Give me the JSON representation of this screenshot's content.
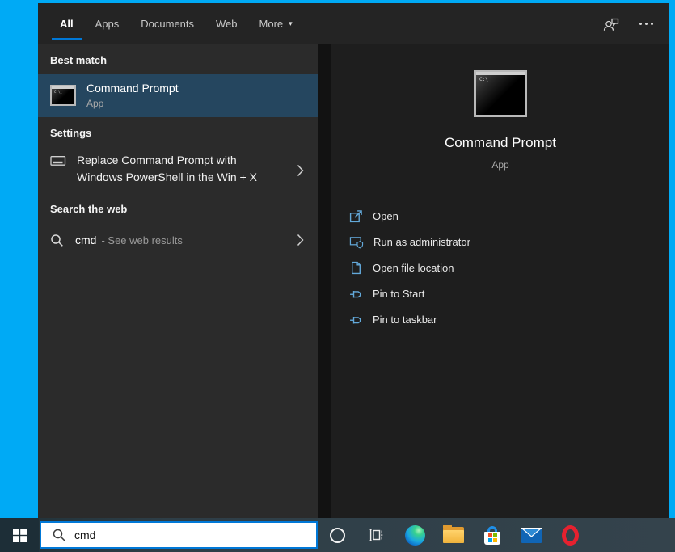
{
  "accent_colors": {
    "accent_blue": "#0078d7",
    "desktop_blue": "#00aaf5",
    "selection_blue": "#25465f",
    "action_icon_blue": "#63a9da",
    "taskbar_color": "#2e3e47"
  },
  "header": {
    "tabs": [
      "All",
      "Apps",
      "Documents",
      "Web",
      "More"
    ],
    "selected_tab": "All",
    "more_caret": "▾",
    "icons": [
      "feedback-person-icon",
      "more-options-ellipsis-icon"
    ]
  },
  "left_panel": {
    "best_match": {
      "section_header": "Best match",
      "title": "Command Prompt",
      "subtitle": "App",
      "icon": "cmd-terminal-icon"
    },
    "settings": {
      "section_header": "Settings",
      "line1": "Replace Command Prompt with",
      "line2": "Windows PowerShell in the Win + X",
      "icon": "window-icon",
      "chevron": "chevron-right"
    },
    "web": {
      "section_header": "Search the web",
      "query": "cmd",
      "suffix": "- See web results",
      "icon": "search-icon",
      "chevron": "chevron-right"
    }
  },
  "right_panel": {
    "app_title": "Command Prompt",
    "app_type": "App",
    "terminal_prompt": "C:\\_",
    "actions": [
      "Open",
      "Run as administrator",
      "Open file location",
      "Pin to Start",
      "Pin to taskbar"
    ]
  },
  "taskbar": {
    "search_value": "cmd",
    "icons": [
      "start",
      "cortana",
      "task-view",
      "edge",
      "file-explorer",
      "store",
      "mail",
      "opera"
    ]
  }
}
